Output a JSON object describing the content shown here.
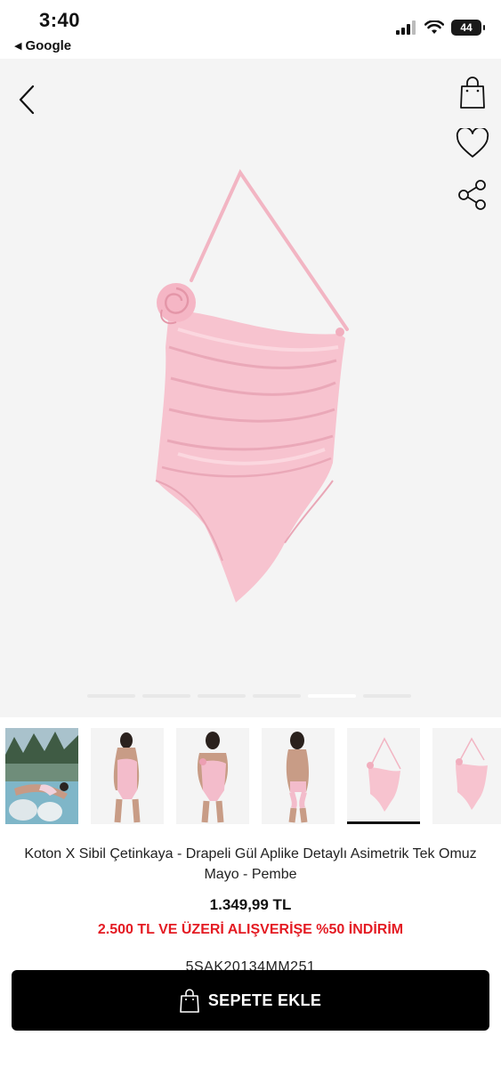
{
  "status_bar": {
    "time": "3:40",
    "back_app": "Google",
    "battery": "44"
  },
  "product": {
    "title": "Koton X Sibil Çetinkaya -  Drapeli Gül Aplike Detaylı Asimetrik Tek Omuz Mayo - Pembe",
    "price": "1.349,99 TL",
    "promo": "2.500 TL VE ÜZERİ ALIŞVERİŞE %50 İNDİRİM",
    "sku": "5SAK20134MM251",
    "color_hex": "#f6bfcb"
  },
  "gallery": {
    "image_count": 6,
    "active_index": 4,
    "thumbnails": [
      "lifestyle-pool",
      "model-front-1",
      "model-front-2",
      "model-back",
      "product-front",
      "product-side"
    ]
  },
  "actions": {
    "add_to_cart": "SEPETE EKLE"
  },
  "icons": {
    "back": "chevron-left-icon",
    "bag": "shopping-bag-icon",
    "favorite": "heart-icon",
    "share": "share-icon"
  }
}
